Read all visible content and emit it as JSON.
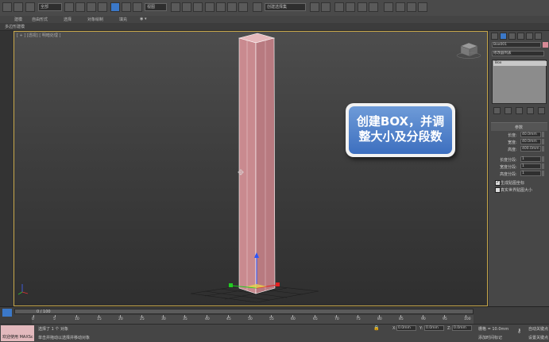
{
  "toolbar": {
    "selection_filter": "全部",
    "reference_coord": "视图",
    "named_selection": "创建选择集"
  },
  "ribbon": {
    "tabs": [
      "建模",
      "自由形式",
      "选择",
      "对象绘制",
      "填充"
    ],
    "subtitle": "多边形建模"
  },
  "viewport": {
    "label": "[ + ] [透视] [ 明暗处理 ]"
  },
  "callout": {
    "line1": "创建BOX，并调",
    "line2": "整大小及分段数"
  },
  "command_panel": {
    "object_name": "Box001",
    "modifier_list": "修改器列表",
    "stack_item": "Box",
    "rollout_title": "参数",
    "length_label": "长度:",
    "length_value": "40.0mm",
    "width_label": "宽度:",
    "width_value": "40.0mm",
    "height_label": "高度:",
    "height_value": "400.0mm",
    "length_segs_label": "长度分段:",
    "length_segs_value": "1",
    "width_segs_label": "宽度分段:",
    "width_segs_value": "1",
    "height_segs_label": "高度分段:",
    "height_segs_value": "1",
    "gen_mapping": "生成贴图坐标",
    "real_world": "真实世界贴图大小"
  },
  "timeline": {
    "frame_counter": "0 / 100",
    "ticks": [
      "0",
      "5",
      "10",
      "15",
      "20",
      "25",
      "30",
      "35",
      "40",
      "45",
      "50",
      "55",
      "60",
      "65",
      "70",
      "75",
      "80",
      "85",
      "90",
      "95",
      "100"
    ]
  },
  "status": {
    "welcome": "欢迎使用 MAXSc",
    "selected": "选择了 1 个 对象",
    "hint": "单击并拖动以选择并移动对象",
    "x_label": "X:",
    "x_value": "0.0mm",
    "y_label": "Y:",
    "y_value": "0.0mm",
    "z_label": "Z:",
    "z_value": "0.0mm",
    "grid": "栅格 = 10.0mm",
    "add_time_tag": "添加时间标记",
    "auto_key": "自动关键点",
    "set_key": "设置关键点"
  },
  "colors": {
    "box_fill": "#c98a8f",
    "viewport_border": "#c8a84b",
    "callout_blue": "#4a7cc8"
  }
}
